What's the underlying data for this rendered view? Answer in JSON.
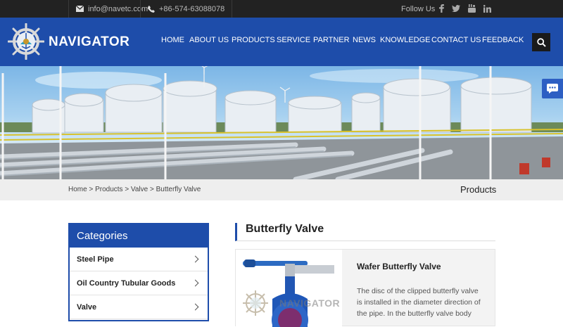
{
  "topbar": {
    "email": "info@navetc.com",
    "phone": "+86-574-63088078",
    "follow_label": "Follow Us",
    "social": [
      "facebook-icon",
      "twitter-icon",
      "youtube-icon",
      "linkedin-icon"
    ]
  },
  "brand": {
    "name": "NAVIGATOR"
  },
  "nav": {
    "items": [
      "HOME",
      "ABOUT US",
      "PRODUCTS",
      "SERVICE",
      "PARTNER",
      "NEWS",
      "KNOWLEDGE",
      "CONTACT US",
      "FEEDBACK"
    ]
  },
  "breadcrumb": {
    "path": "Home > Products > Valve > Butterfly Valve",
    "title": "Products"
  },
  "sidebar": {
    "heading": "Categories",
    "items": [
      "Steel Pipe",
      "Oil Country Tubular Goods",
      "Valve"
    ]
  },
  "main": {
    "title": "Butterfly Valve",
    "product": {
      "name": "Wafer Butterfly Valve",
      "watermark": "NAVIGATOR",
      "desc": "The disc of the clipped butterfly valve is installed in the diameter direction of the pipe. In the butterfly valve body"
    }
  },
  "colors": {
    "brand_blue": "#1e4daa",
    "topbar": "#222222"
  }
}
